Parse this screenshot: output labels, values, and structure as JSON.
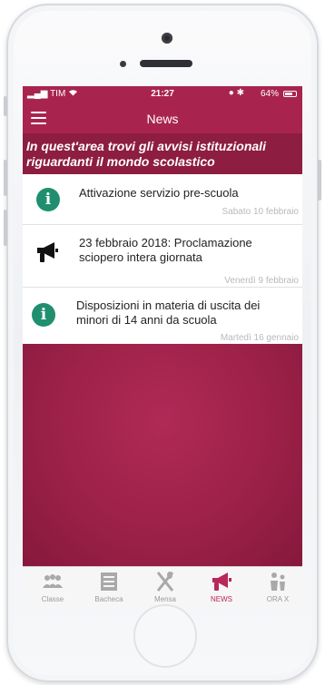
{
  "status_bar": {
    "carrier": "TIM",
    "time": "21:27",
    "battery": "64%"
  },
  "header": {
    "title": "News"
  },
  "banner": {
    "line1": "In quest'area trovi gli avvisi istituzionali",
    "line2": "riguardanti il mondo scolastico"
  },
  "news": [
    {
      "icon": "info-icon",
      "title": "Attivazione servizio pre-scuola",
      "date": "Sabato 10 febbraio"
    },
    {
      "icon": "megaphone-icon",
      "title_line1": "23 febbraio 2018: Proclamazione",
      "title_line2": "sciopero intera giornata",
      "date": "Venerdì 9 febbraio"
    },
    {
      "icon": "info-icon",
      "title_line1": "Disposizioni in materia di uscita dei",
      "title_line2": "minori di 14 anni da scuola",
      "date": "Martedì 16 gennaio"
    }
  ],
  "tabs": [
    {
      "label": "Classe",
      "icon": "people-icon",
      "active": false
    },
    {
      "label": "Bacheca",
      "icon": "board-icon",
      "active": false
    },
    {
      "label": "Mensa",
      "icon": "cutlery-icon",
      "active": false
    },
    {
      "label": "NEWS",
      "icon": "megaphone-icon",
      "active": true
    },
    {
      "label": "ORA X",
      "icon": "children-icon",
      "active": false
    }
  ],
  "colors": {
    "primary": "#a8244f",
    "banner": "#8d1d41",
    "info_green": "#1f8f6f",
    "active_tab": "#b8285a"
  }
}
